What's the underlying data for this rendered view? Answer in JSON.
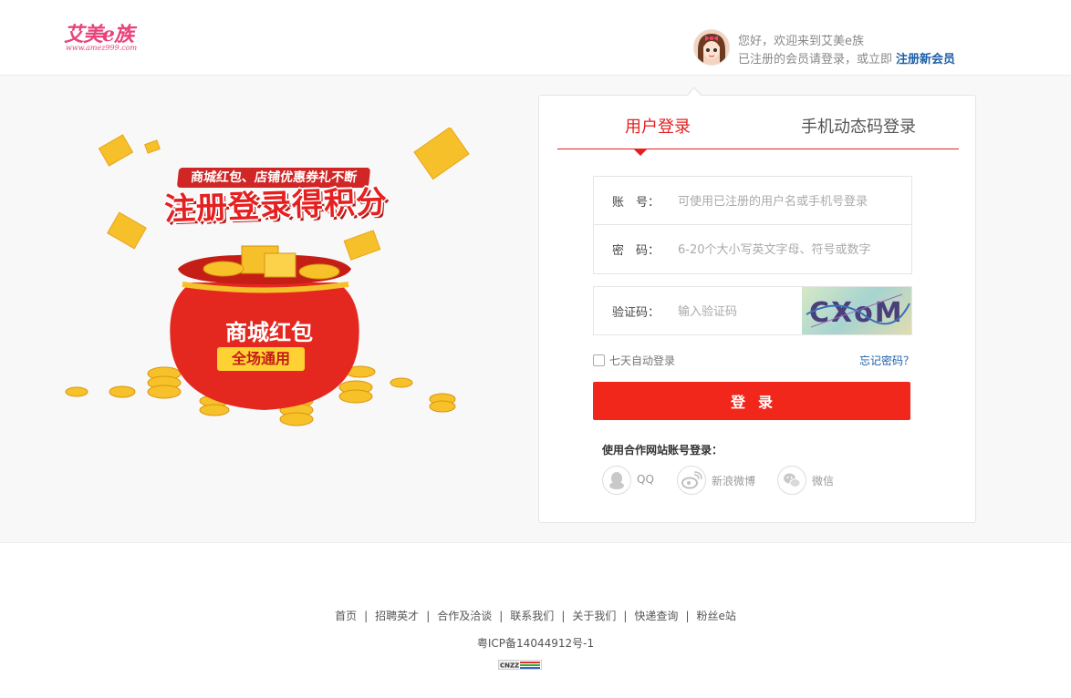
{
  "header": {
    "logo_main": "艾美e族",
    "logo_sub": "www.amez999.com",
    "welcome_line1": "您好，欢迎来到艾美e族",
    "welcome_line2": "已注册的会员请登录，或立即",
    "register_link": "注册新会员"
  },
  "promo": {
    "small_banner": "商城红包、店铺优惠券礼不断",
    "big_banner": "注册登录得积分",
    "bag_title": "商城红包",
    "bag_tag": "全场通用"
  },
  "login": {
    "tabs": [
      {
        "label": "用户登录",
        "active": true
      },
      {
        "label": "手机动态码登录",
        "active": false
      }
    ],
    "account_label": "账　号：",
    "account_placeholder": "可使用已注册的用户名或手机号登录",
    "password_label": "密　码：",
    "password_placeholder": "6-20个大小写英文字母、符号或数字",
    "captcha_label": "验证码：",
    "captcha_placeholder": "输入验证码",
    "captcha_text": "CXoM",
    "remember_label": "七天自动登录",
    "forgot_label": "忘记密码？",
    "submit_label": "登录",
    "partner_title": "使用合作网站账号登录：",
    "partners": [
      {
        "label": "QQ",
        "icon": "qq-icon"
      },
      {
        "label": "新浪微博",
        "icon": "weibo-icon"
      },
      {
        "label": "微信",
        "icon": "wechat-icon"
      }
    ]
  },
  "footer": {
    "links": [
      "首页",
      "招聘英才",
      "合作及洽谈",
      "联系我们",
      "关于我们",
      "快递查询",
      "粉丝e站"
    ],
    "icp": "粤ICP备14044912号-1",
    "badge": "CNZZ"
  },
  "colors": {
    "accent_red": "#e52020",
    "button_red": "#f2271b",
    "link_blue": "#1d5fa8",
    "brand_pink": "#e8437a"
  }
}
